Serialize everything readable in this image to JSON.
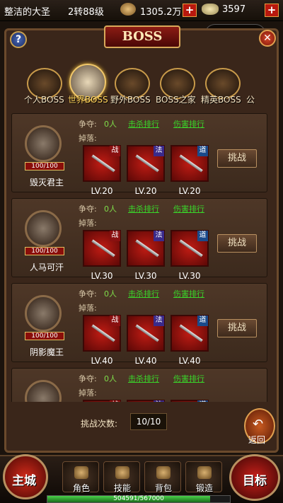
{
  "topbar": {
    "player_name": "整洁的大圣",
    "level": "2转88级",
    "gold": "1305.2万",
    "ingot": "3597",
    "plus_label": "+"
  },
  "capsule": {
    "menu_dots": "•••"
  },
  "panel": {
    "title": "BOSS",
    "help_label": "?",
    "close_label": "✕"
  },
  "tabs": [
    {
      "label": "个人BOSS",
      "selected": false
    },
    {
      "label": "世界BOSS",
      "selected": true
    },
    {
      "label": "野外BOSS",
      "selected": false
    },
    {
      "label": "BOSS之家",
      "selected": false
    },
    {
      "label": "精英BOSS",
      "selected": false
    },
    {
      "label": "公",
      "selected": false
    }
  ],
  "labels": {
    "contest": "争夺:",
    "drops": "掉落:",
    "kill_rank": "击杀排行",
    "damage_rank": "伤害排行",
    "challenge": "挑战"
  },
  "bosses": [
    {
      "name": "毁灭君主",
      "hp": "100/100",
      "contest": "0人",
      "items": [
        {
          "class": "战",
          "cls": "warrior",
          "level": "LV.20"
        },
        {
          "class": "法",
          "cls": "mage",
          "level": "LV.20"
        },
        {
          "class": "道",
          "cls": "taoist",
          "level": "LV.20"
        }
      ]
    },
    {
      "name": "人马可汗",
      "hp": "100/100",
      "contest": "0人",
      "items": [
        {
          "class": "战",
          "cls": "warrior",
          "level": "LV.30"
        },
        {
          "class": "法",
          "cls": "mage",
          "level": "LV.30"
        },
        {
          "class": "道",
          "cls": "taoist",
          "level": "LV.30"
        }
      ]
    },
    {
      "name": "阴影魔王",
      "hp": "100/100",
      "contest": "0人",
      "items": [
        {
          "class": "战",
          "cls": "warrior",
          "level": "LV.40"
        },
        {
          "class": "法",
          "cls": "mage",
          "level": "LV.40"
        },
        {
          "class": "道",
          "cls": "taoist",
          "level": "LV.40"
        }
      ]
    },
    {
      "name": "",
      "hp": "",
      "contest": "0人",
      "items": [
        {
          "class": "战",
          "cls": "warrior",
          "level": ""
        },
        {
          "class": "法",
          "cls": "mage",
          "level": ""
        },
        {
          "class": "道",
          "cls": "taoist",
          "level": ""
        }
      ]
    }
  ],
  "bottom": {
    "count_label": "挑战次数:",
    "count_value": "10/10",
    "back_label": "返回",
    "back_icon": "↶"
  },
  "menubar": {
    "city": "主城",
    "goal": "目标",
    "items": [
      "角色",
      "技能",
      "背包",
      "锻造"
    ],
    "exp_text": "504591/567000",
    "exp_fraction": 0.89
  }
}
